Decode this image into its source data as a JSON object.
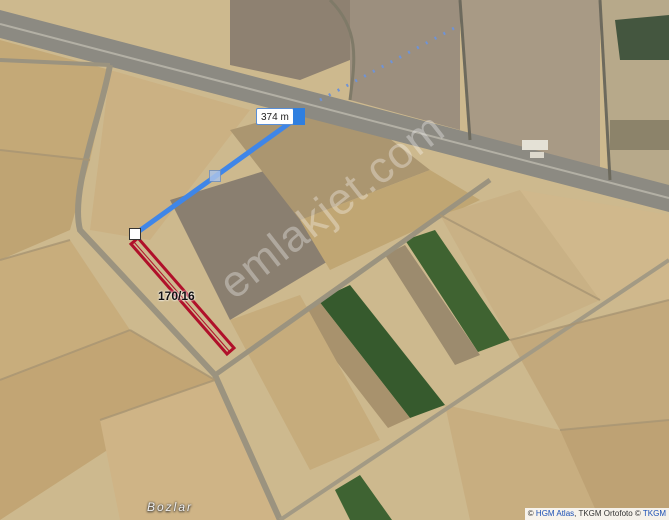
{
  "map": {
    "distance_label": "374 m",
    "parcel_label": "170/16",
    "place_name": "Bozlar",
    "watermark": "emlakjet.com",
    "attribution": {
      "prefix": "© ",
      "hgm": "HGM Atlas",
      "sep": ", TKGM Ortofoto © ",
      "tkgm": "TKGM"
    },
    "colors": {
      "measure_line": "#3f86e8",
      "parcel_outline": "#b0102a"
    }
  }
}
